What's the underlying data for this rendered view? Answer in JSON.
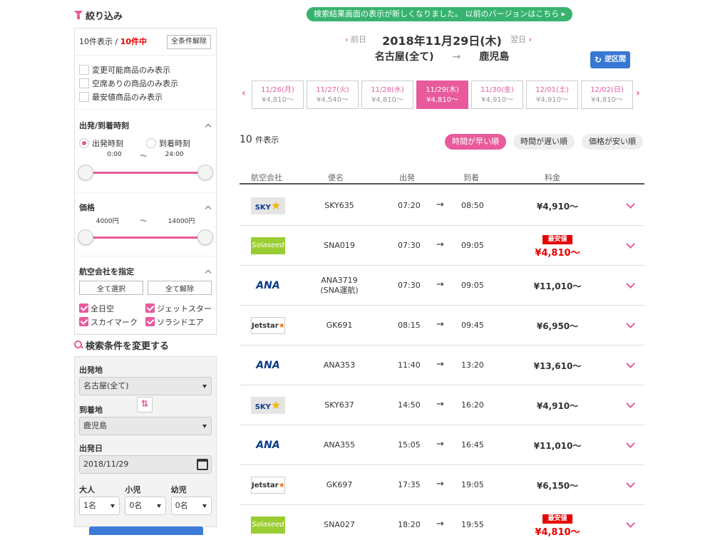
{
  "filter": {
    "title": "絞り込み",
    "count_prefix": "10件表示 / ",
    "count_value": "10件中",
    "clear_all": "全条件解除",
    "options": [
      "変更可能商品のみ表示",
      "空席ありの商品のみ表示",
      "最安値商品のみ表示"
    ],
    "time": {
      "title": "出発/到着時刻",
      "radio_departure": "出発時刻",
      "radio_arrival": "到着時刻",
      "selected": "departure",
      "from": "0:00",
      "sep": "〜",
      "to": "24:00"
    },
    "price": {
      "title": "価格",
      "from": "4000円",
      "sep": "〜",
      "to": "14000円"
    },
    "airline": {
      "title": "航空会社を指定",
      "select_all": "全て選択",
      "deselect_all": "全て解除",
      "items": [
        "全日空",
        "ジェットスター",
        "スカイマーク",
        "ソラシドエア"
      ]
    }
  },
  "search": {
    "title": "検索条件を変更する",
    "origin_label": "出発地",
    "origin_value": "名古屋(全て)",
    "dest_label": "到着地",
    "dest_value": "鹿児島",
    "swap_icon": "⇅",
    "date_label": "出発日",
    "date_value": "2018/11/29",
    "adult_label": "大人",
    "adult_value": "1名",
    "child_label": "小児",
    "child_value": "0名",
    "infant_label": "幼児",
    "infant_value": "0名"
  },
  "header": {
    "notice": "検索結果画面の表示が新しくなりました。 以前のバージョンはこちら ▸",
    "prev_day": "前日",
    "next_day": "翌日",
    "current_date": "2018年11月29日(木)",
    "origin": "名古屋(全て)",
    "route_arrow": "→",
    "destination": "鹿児島",
    "reverse_button": "逆区間"
  },
  "date_tabs": [
    {
      "date": "11/26(月)",
      "price": "¥4,810〜",
      "selected": false
    },
    {
      "date": "11/27(火)",
      "price": "¥4,540〜",
      "selected": false
    },
    {
      "date": "11/28(水)",
      "price": "¥4,810〜",
      "selected": false
    },
    {
      "date": "11/29(木)",
      "price": "¥4,810〜",
      "selected": true
    },
    {
      "date": "11/30(金)",
      "price": "¥4,910〜",
      "selected": false
    },
    {
      "date": "12/01(土)",
      "price": "¥4,910〜",
      "selected": false
    },
    {
      "date": "12/02(日)",
      "price": "¥4,810〜",
      "selected": false
    }
  ],
  "results": {
    "count": "10",
    "count_label": "件表示",
    "sort_options": [
      "時間が早い順",
      "時間が遅い順",
      "価格が安い順"
    ],
    "columns": [
      "航空会社",
      "便名",
      "出発",
      "到着",
      "料金"
    ],
    "cheapest_badge": "最安値",
    "flights": [
      {
        "airline": "SKY",
        "logo": "sky",
        "flight": "SKY635",
        "flight2": "",
        "dep": "07:20",
        "arr": "08:50",
        "price": "¥4,910〜",
        "cheapest": false
      },
      {
        "airline": "Solaseed",
        "logo": "sol",
        "flight": "SNA019",
        "flight2": "",
        "dep": "07:30",
        "arr": "09:05",
        "price": "¥4,810〜",
        "cheapest": true
      },
      {
        "airline": "ANA",
        "logo": "ana",
        "flight": "ANA3719",
        "flight2": "(SNA運航)",
        "dep": "07:30",
        "arr": "09:05",
        "price": "¥11,010〜",
        "cheapest": false
      },
      {
        "airline": "Jetstar",
        "logo": "jet",
        "flight": "GK691",
        "flight2": "",
        "dep": "08:15",
        "arr": "09:45",
        "price": "¥6,950〜",
        "cheapest": false
      },
      {
        "airline": "ANA",
        "logo": "ana",
        "flight": "ANA353",
        "flight2": "",
        "dep": "11:40",
        "arr": "13:20",
        "price": "¥13,610〜",
        "cheapest": false
      },
      {
        "airline": "SKY",
        "logo": "sky",
        "flight": "SKY637",
        "flight2": "",
        "dep": "14:50",
        "arr": "16:20",
        "price": "¥4,910〜",
        "cheapest": false
      },
      {
        "airline": "ANA",
        "logo": "ana",
        "flight": "ANA355",
        "flight2": "",
        "dep": "15:05",
        "arr": "16:45",
        "price": "¥11,010〜",
        "cheapest": false
      },
      {
        "airline": "Jetstar",
        "logo": "jet",
        "flight": "GK697",
        "flight2": "",
        "dep": "17:35",
        "arr": "19:05",
        "price": "¥6,150〜",
        "cheapest": false
      },
      {
        "airline": "Solaseed",
        "logo": "sol",
        "flight": "SNA027",
        "flight2": "",
        "dep": "18:20",
        "arr": "19:55",
        "price": "¥4,810〜",
        "cheapest": true
      }
    ]
  },
  "colors": {
    "accent": "#e85a9c",
    "notice_bg": "#37b36f",
    "reverse_bg": "#3878d3",
    "cheap": "#e60000"
  }
}
